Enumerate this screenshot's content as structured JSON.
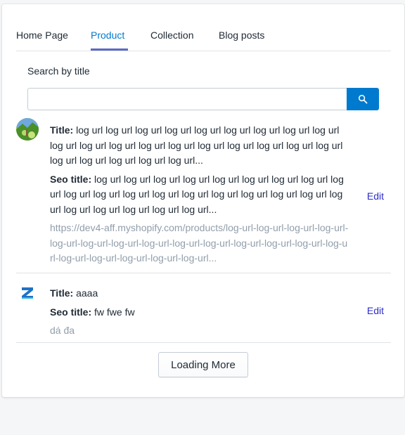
{
  "tabs": [
    {
      "label": "Home Page",
      "active": false
    },
    {
      "label": "Product",
      "active": true
    },
    {
      "label": "Collection",
      "active": false
    },
    {
      "label": "Blog posts",
      "active": false
    }
  ],
  "search": {
    "label": "Search by title",
    "value": "",
    "placeholder": ""
  },
  "field_labels": {
    "title": "Title:",
    "seo_title": "Seo title:"
  },
  "items": [
    {
      "title": "log url log url log url log url log url log url log url log url log url log url log url log url log url log url log url log url log url log url log url log url log url log url log url log url...",
      "seo_title": "log url log url log url log url log url log url log url log url log url log url log url log url log url log url log url log url log url log url log url log url log url log url log url log url...",
      "url": "https://dev4-aff.myshopify.com/products/log-url-log-url-log-url-log-url-log-url-log-url-log-url-log-url-log-url-log-url-log-url-log-url-log-url-log-url-log-url-log-url-log-url-log-url-log-url...",
      "edit_label": "Edit",
      "avatar_icon": "landscape-thumbnail"
    },
    {
      "title": "aaaa",
      "seo_title": "fw fwe fw",
      "url": "dá đa",
      "edit_label": "Edit",
      "avatar_icon": "z-logo-icon"
    }
  ],
  "load_more_label": "Loading More",
  "colors": {
    "accent": "#007ace",
    "tab_underline": "#5c6ac4",
    "edit_link": "#2c2cc9",
    "muted_text": "#919eab"
  }
}
